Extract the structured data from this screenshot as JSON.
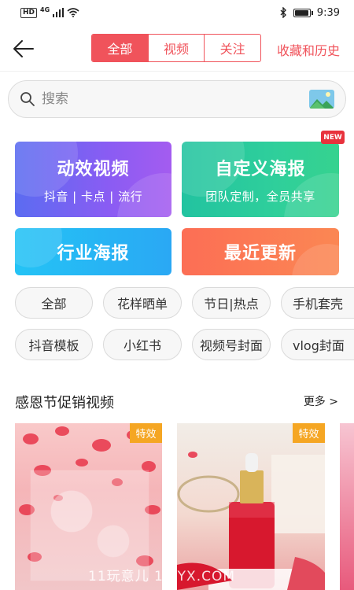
{
  "status_bar": {
    "hd": "HD",
    "network": "4G",
    "time": "9:39"
  },
  "header": {
    "tabs": [
      {
        "label": "全部",
        "active": true
      },
      {
        "label": "视频",
        "active": false
      },
      {
        "label": "关注",
        "active": false
      }
    ],
    "history_label": "收藏和历史"
  },
  "search": {
    "placeholder": "搜索"
  },
  "cards": {
    "dynamic_video": {
      "title": "动效视频",
      "subtitle": "抖音 | 卡点 | 流行"
    },
    "custom_poster": {
      "title": "自定义海报",
      "subtitle": "团队定制，全员共享",
      "badge": "NEW"
    },
    "industry_poster": {
      "title": "行业海报"
    },
    "recent_updates": {
      "title": "最近更新"
    }
  },
  "chips_row1": [
    "全部",
    "花样晒单",
    "节日|热点",
    "手机套壳"
  ],
  "chips_row2": [
    "抖音模板",
    "小红书",
    "视频号封面",
    "vlog封面"
  ],
  "section": {
    "title": "感恩节促销视频",
    "more_label": "更多 >"
  },
  "thumbnails": [
    {
      "badge": "特效"
    },
    {
      "badge": "特效"
    }
  ],
  "watermark": "11玩意儿 1WYX.COM",
  "colors": {
    "accent": "#f0535b",
    "badge_orange": "#f5a623",
    "new_red": "#e8323c"
  }
}
